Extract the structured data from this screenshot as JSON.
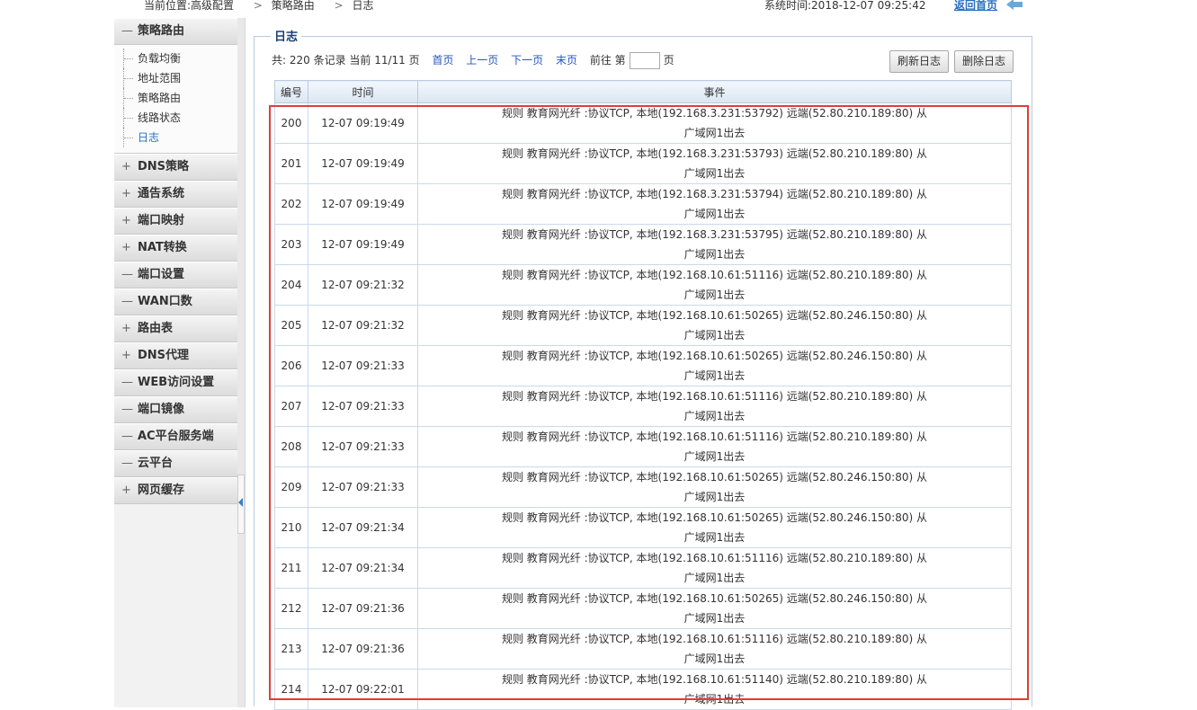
{
  "header": {
    "location_label": "当前位置:高级配置",
    "crumb1": "策略路由",
    "crumb2": "日志",
    "crumb_sep": ">",
    "system_time": "系统时间:2018-12-07 09:25:42",
    "home_link": "返回首页"
  },
  "sidebar": {
    "active_category": {
      "symbol": "—",
      "label": "策略路由"
    },
    "sub_items": [
      {
        "label": "负载均衡",
        "active": false
      },
      {
        "label": "地址范围",
        "active": false
      },
      {
        "label": "策略路由",
        "active": false
      },
      {
        "label": "线路状态",
        "active": false
      },
      {
        "label": "日志",
        "active": true
      }
    ],
    "categories": [
      {
        "symbol": "+",
        "label": "DNS策略"
      },
      {
        "symbol": "+",
        "label": "通告系统"
      },
      {
        "symbol": "+",
        "label": "端口映射"
      },
      {
        "symbol": "+",
        "label": "NAT转换"
      },
      {
        "symbol": "—",
        "label": "端口设置"
      },
      {
        "symbol": "—",
        "label": "WAN口数"
      },
      {
        "symbol": "+",
        "label": "路由表"
      },
      {
        "symbol": "+",
        "label": "DNS代理"
      },
      {
        "symbol": "—",
        "label": "WEB访问设置"
      },
      {
        "symbol": "—",
        "label": "端口镜像"
      },
      {
        "symbol": "—",
        "label": "AC平台服务端"
      },
      {
        "symbol": "—",
        "label": "云平台"
      },
      {
        "symbol": "+",
        "label": "网页缓存"
      }
    ]
  },
  "panel": {
    "title": "日志",
    "pager": {
      "summary": "共: 220 条记录 当前 11/11 页",
      "first": "首页",
      "prev": "上一页",
      "next": "下一页",
      "last": "末页",
      "goto_prefix": "前往 第",
      "goto_value": "",
      "goto_suffix": "页"
    },
    "refresh_button": "刷新日志",
    "delete_button": "删除日志"
  },
  "table": {
    "headers": [
      "编号",
      "时间",
      "事件"
    ],
    "rows": [
      {
        "id": "200",
        "time": "12-07 09:19:49",
        "line1": "规则 教育网光纤 :协议TCP, 本地(192.168.3.231:53792) 远端(52.80.210.189:80) 从",
        "line2": "广域网1出去"
      },
      {
        "id": "201",
        "time": "12-07 09:19:49",
        "line1": "规则 教育网光纤 :协议TCP, 本地(192.168.3.231:53793) 远端(52.80.210.189:80) 从",
        "line2": "广域网1出去"
      },
      {
        "id": "202",
        "time": "12-07 09:19:49",
        "line1": "规则 教育网光纤 :协议TCP, 本地(192.168.3.231:53794) 远端(52.80.210.189:80) 从",
        "line2": "广域网1出去"
      },
      {
        "id": "203",
        "time": "12-07 09:19:49",
        "line1": "规则 教育网光纤 :协议TCP, 本地(192.168.3.231:53795) 远端(52.80.210.189:80) 从",
        "line2": "广域网1出去"
      },
      {
        "id": "204",
        "time": "12-07 09:21:32",
        "line1": "规则 教育网光纤 :协议TCP, 本地(192.168.10.61:51116) 远端(52.80.210.189:80) 从",
        "line2": "广域网1出去"
      },
      {
        "id": "205",
        "time": "12-07 09:21:32",
        "line1": "规则 教育网光纤 :协议TCP, 本地(192.168.10.61:50265) 远端(52.80.246.150:80) 从",
        "line2": "广域网1出去"
      },
      {
        "id": "206",
        "time": "12-07 09:21:33",
        "line1": "规则 教育网光纤 :协议TCP, 本地(192.168.10.61:50265) 远端(52.80.246.150:80) 从",
        "line2": "广域网1出去"
      },
      {
        "id": "207",
        "time": "12-07 09:21:33",
        "line1": "规则 教育网光纤 :协议TCP, 本地(192.168.10.61:51116) 远端(52.80.210.189:80) 从",
        "line2": "广域网1出去"
      },
      {
        "id": "208",
        "time": "12-07 09:21:33",
        "line1": "规则 教育网光纤 :协议TCP, 本地(192.168.10.61:51116) 远端(52.80.210.189:80) 从",
        "line2": "广域网1出去"
      },
      {
        "id": "209",
        "time": "12-07 09:21:33",
        "line1": "规则 教育网光纤 :协议TCP, 本地(192.168.10.61:50265) 远端(52.80.246.150:80) 从",
        "line2": "广域网1出去"
      },
      {
        "id": "210",
        "time": "12-07 09:21:34",
        "line1": "规则 教育网光纤 :协议TCP, 本地(192.168.10.61:50265) 远端(52.80.246.150:80) 从",
        "line2": "广域网1出去"
      },
      {
        "id": "211",
        "time": "12-07 09:21:34",
        "line1": "规则 教育网光纤 :协议TCP, 本地(192.168.10.61:51116) 远端(52.80.210.189:80) 从",
        "line2": "广域网1出去"
      },
      {
        "id": "212",
        "time": "12-07 09:21:36",
        "line1": "规则 教育网光纤 :协议TCP, 本地(192.168.10.61:50265) 远端(52.80.246.150:80) 从",
        "line2": "广域网1出去"
      },
      {
        "id": "213",
        "time": "12-07 09:21:36",
        "line1": "规则 教育网光纤 :协议TCP, 本地(192.168.10.61:51116) 远端(52.80.210.189:80) 从",
        "line2": "广域网1出去"
      },
      {
        "id": "214",
        "time": "12-07 09:22:01",
        "line1": "规则 教育网光纤 :协议TCP, 本地(192.168.10.61:51140) 远端(52.80.210.189:80) 从",
        "line2": "广域网1出去"
      }
    ]
  },
  "colors": {
    "highlight_border": "#e23b3b",
    "link": "#2a57c0",
    "title": "#1c3f73"
  }
}
